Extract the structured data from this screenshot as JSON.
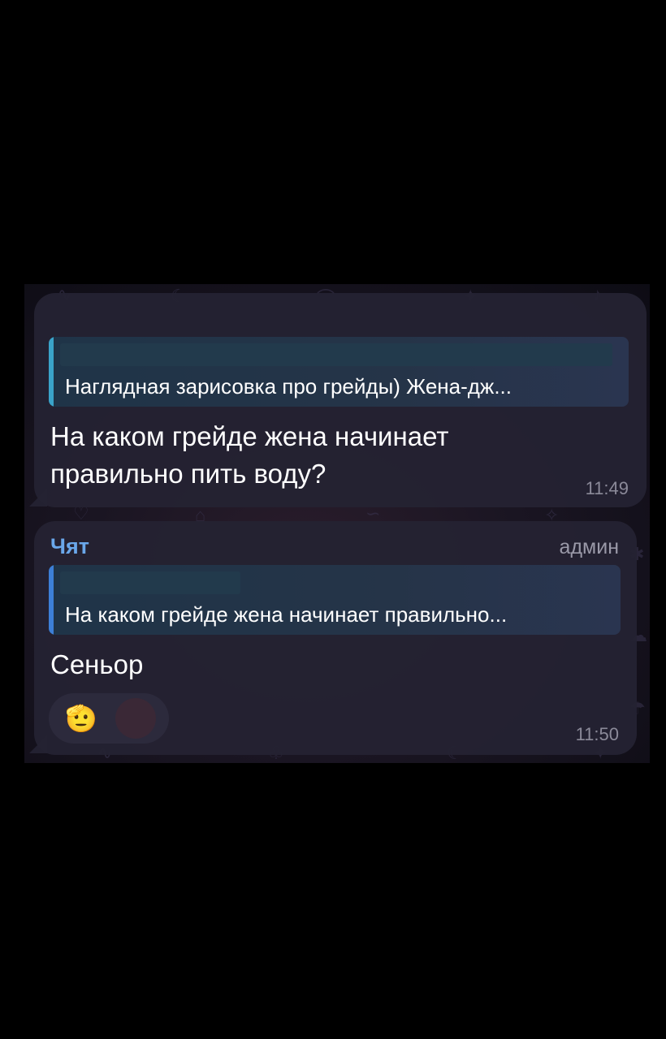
{
  "messages": [
    {
      "reply": {
        "text": "Наглядная зарисовка про грейды) Жена-дж..."
      },
      "text_lines": [
        "На каком грейде жена начинает",
        "правильно пить воду?"
      ],
      "time": "11:49"
    },
    {
      "sender": "Чят",
      "role": "админ",
      "reply": {
        "text": "На каком грейде жена начинает правильно..."
      },
      "text": "Сеньор",
      "reaction": {
        "emoji": "🫡"
      },
      "time": "11:50"
    }
  ],
  "colors": {
    "background": "#000000",
    "bubble": "#242232",
    "reply_bar_1": "#3aa3c9",
    "reply_bar_2": "#3d7fd6",
    "sender": "#6aa7ea"
  },
  "icons": {
    "reaction": "saluting-face-icon",
    "reaction_avatar": "user-avatar-icon"
  }
}
